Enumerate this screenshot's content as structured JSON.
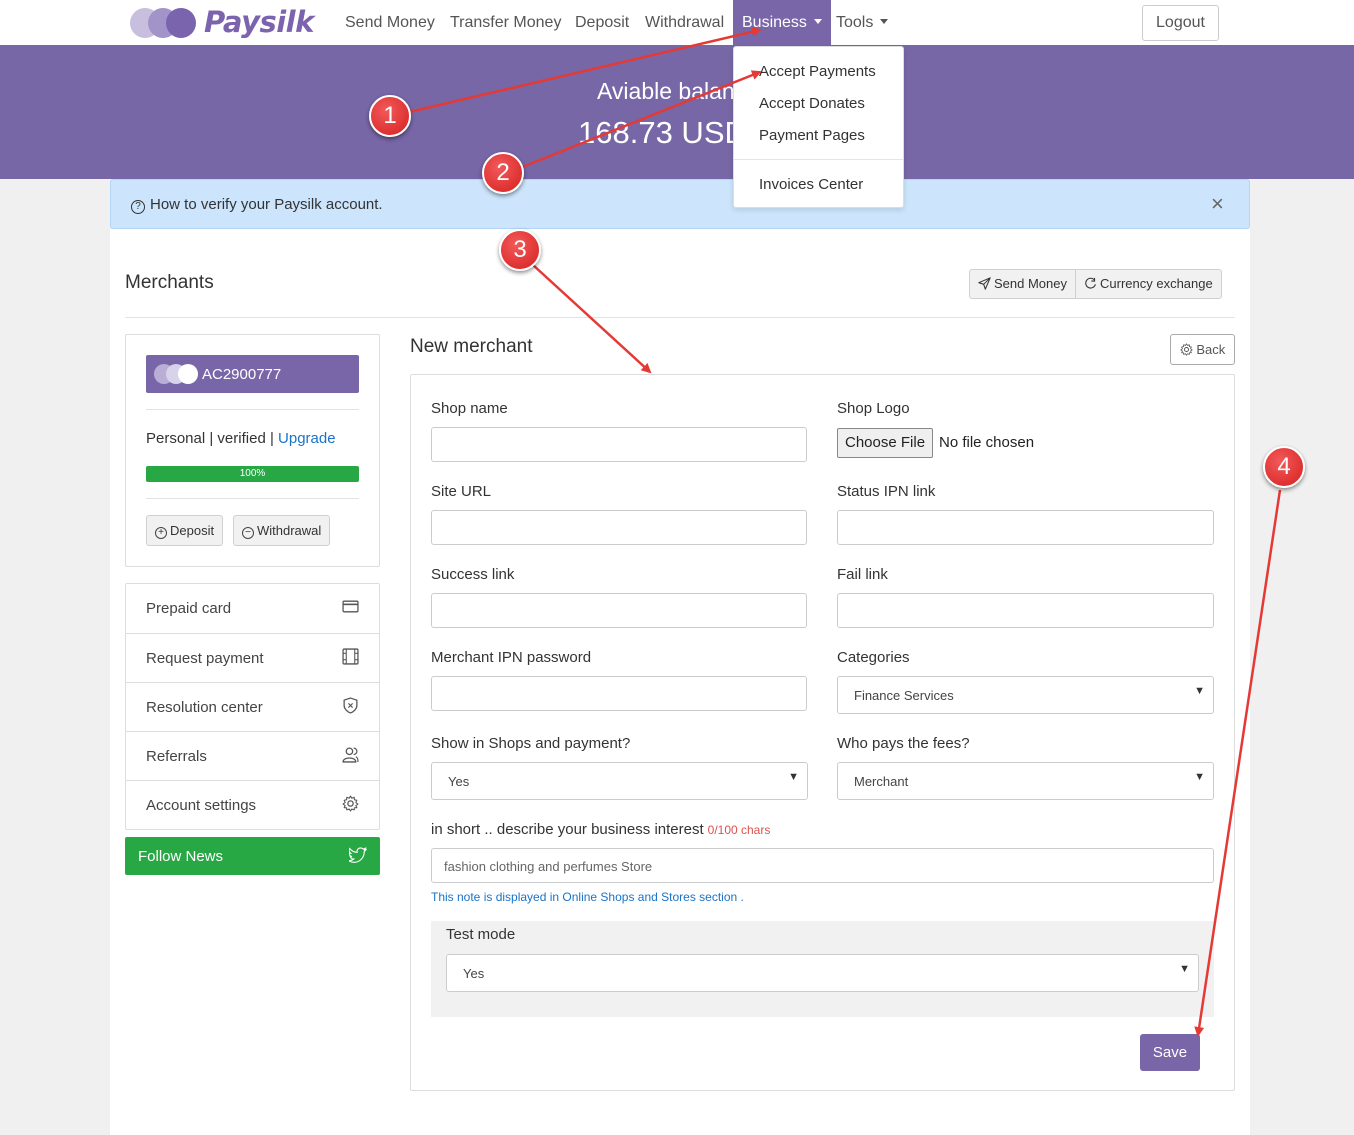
{
  "brand": {
    "name": "Paysilk"
  },
  "nav": {
    "items": [
      {
        "label": "Send Money"
      },
      {
        "label": "Transfer Money"
      },
      {
        "label": "Deposit"
      },
      {
        "label": "Withdrawal"
      },
      {
        "label": "Business"
      },
      {
        "label": "Tools"
      }
    ],
    "logout": "Logout"
  },
  "banner": {
    "label": "Aviable balance",
    "amount": "168.73 USD"
  },
  "business_menu": {
    "items": [
      "Accept Payments",
      "Accept Donates",
      "Payment Pages",
      "Invoices Center"
    ]
  },
  "alert": {
    "text": "How to verify your Paysilk account.",
    "close": "×"
  },
  "page": {
    "title": "Merchants",
    "actions": {
      "send_money": "Send Money",
      "currency_exchange": "Currency exchange"
    }
  },
  "profile": {
    "account_id": "AC2900777",
    "status_prefix": "Personal | verified | ",
    "upgrade": "Upgrade",
    "progress_label": "100%",
    "progress": 1.0,
    "deposit": "Deposit",
    "withdrawal": "Withdrawal"
  },
  "side_menu": {
    "items": [
      {
        "label": "Prepaid card",
        "icon": "credit-card-icon"
      },
      {
        "label": "Request payment",
        "icon": "film-icon"
      },
      {
        "label": "Resolution center",
        "icon": "shield-icon"
      },
      {
        "label": "Referrals",
        "icon": "users-icon"
      },
      {
        "label": "Account settings",
        "icon": "gear-icon"
      }
    ],
    "follow_news": "Follow News"
  },
  "form": {
    "title": "New merchant",
    "back": "Back",
    "shop_name_label": "Shop name",
    "shop_logo_label": "Shop Logo",
    "choose_file": "Choose File",
    "no_file": "No file chosen",
    "site_url_label": "Site URL",
    "status_ipn_label": "Status IPN link",
    "success_link_label": "Success link",
    "fail_link_label": "Fail link",
    "ipn_password_label": "Merchant IPN password",
    "categories_label": "Categories",
    "categories_value": "Finance Services",
    "show_in_shops_label": "Show in Shops and payment?",
    "show_in_shops_value": "Yes",
    "who_pays_label": "Who pays the fees?",
    "who_pays_value": "Merchant",
    "describe_label": "in short .. describe your business interest",
    "describe_counter": "0/100 chars",
    "describe_placeholder": "fashion clothing and perfumes Store",
    "note": "This note is displayed in Online Shops and Stores section .",
    "test_mode_label": "Test mode",
    "test_mode_value": "Yes",
    "save": "Save"
  },
  "annotations": {
    "markers": [
      "1",
      "2",
      "3",
      "4"
    ],
    "color": "#e53935"
  },
  "colors": {
    "brand": "#7966a8",
    "success": "#28a745",
    "alert_bg": "#cce5fc",
    "link": "#1a73c8"
  }
}
